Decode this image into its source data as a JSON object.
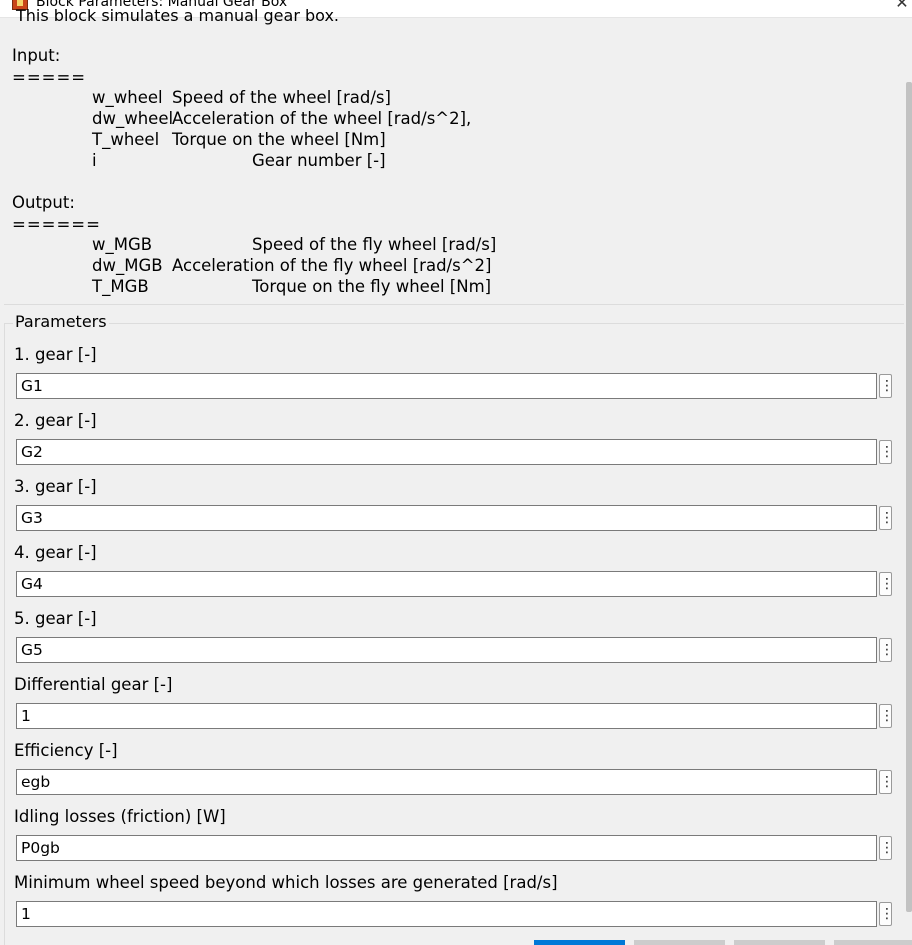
{
  "window": {
    "title": "Block Parameters: Manual Gear Box",
    "close_glyph": "✕"
  },
  "description": {
    "first_line": "This block simulates a manual gear box.",
    "input_header": "Input:",
    "input_rule": "=====",
    "inputs": [
      {
        "name": "w_wheel",
        "desc": "Speed of the wheel [rad/s]"
      },
      {
        "name": "dw_wheel",
        "desc": "Acceleration of the wheel [rad/s^2],"
      },
      {
        "name": "T_wheel",
        "desc": "Torque on the wheel [Nm]"
      },
      {
        "name": "i",
        "desc": "Gear number [-]"
      }
    ],
    "output_header": "Output:",
    "output_rule": "======",
    "outputs": [
      {
        "name": "w_MGB",
        "desc": "Speed of the fly wheel [rad/s]"
      },
      {
        "name": "dw_MGB",
        "desc": "Acceleration of the fly wheel [rad/s^2]"
      },
      {
        "name": "T_MGB",
        "desc": "Torque on the fly wheel [Nm]"
      }
    ]
  },
  "parameters": {
    "title": "Parameters",
    "more_glyph": "⋮",
    "fields": [
      {
        "label": "1. gear [-]",
        "value": "G1"
      },
      {
        "label": "2. gear [-]",
        "value": "G2"
      },
      {
        "label": "3. gear [-]",
        "value": "G3"
      },
      {
        "label": "4. gear [-]",
        "value": "G4"
      },
      {
        "label": "5. gear [-]",
        "value": "G5"
      },
      {
        "label": "Differential gear [-]",
        "value": "1"
      },
      {
        "label": "Efficiency [-]",
        "value": "egb"
      },
      {
        "label": "Idling losses (friction) [W]",
        "value": "P0gb"
      },
      {
        "label": "Minimum wheel speed beyond which losses are generated [rad/s]",
        "value": "1"
      }
    ]
  },
  "colors": {
    "background": "#f0f0f0",
    "field_background": "#ffffff",
    "field_border": "#7a7a7a",
    "button_accent": "#0078d7"
  }
}
